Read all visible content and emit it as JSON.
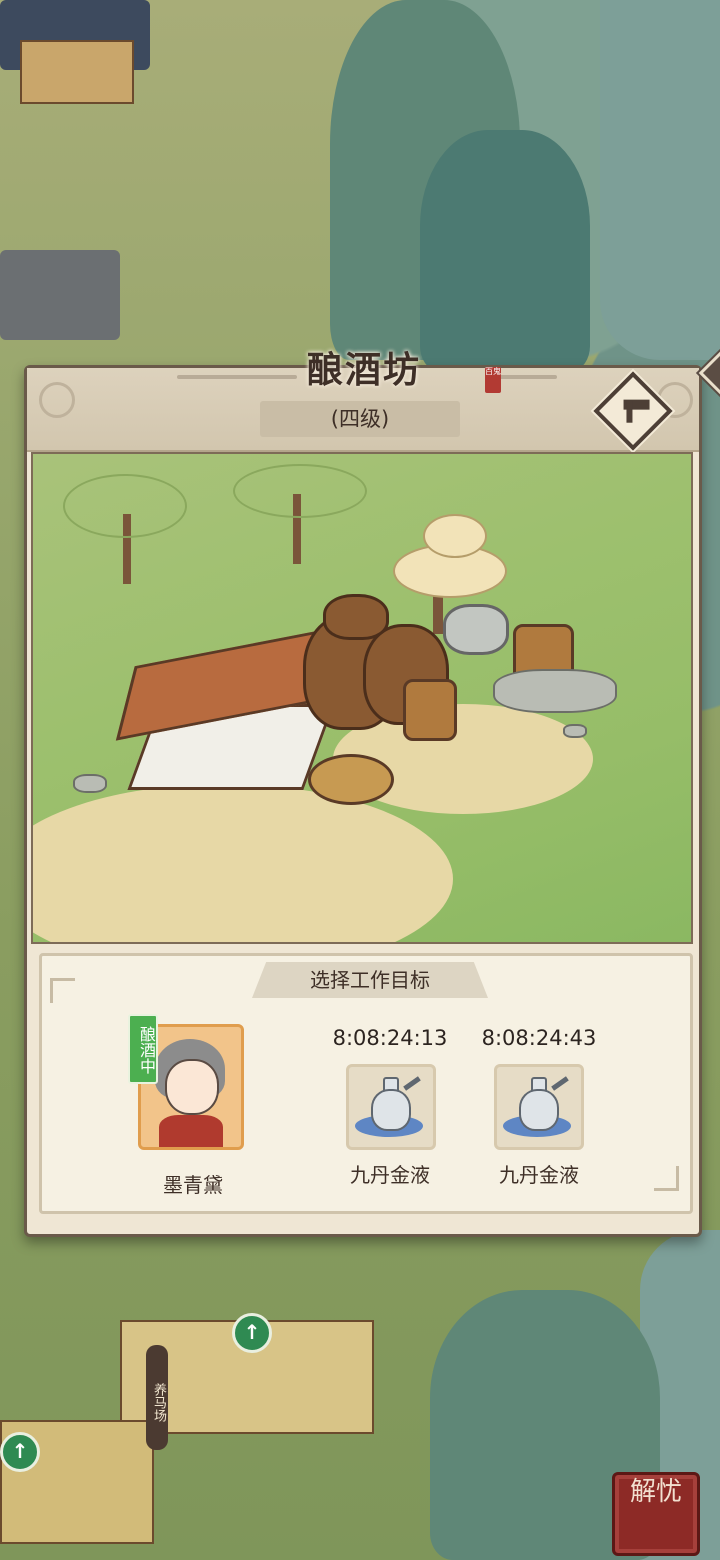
{
  "building": {
    "title": "酿酒坊",
    "level": "(四级)",
    "help_glyph": "?",
    "stamp": "百鬼"
  },
  "work": {
    "heading": "选择工作目标",
    "worker": {
      "name": "墨青黛",
      "status": "酿酒中"
    },
    "products": [
      {
        "timer": "8:08:24:13",
        "name": "九丹金液"
      },
      {
        "timer": "8:08:24:43",
        "name": "九丹金液"
      }
    ]
  },
  "map": {
    "stable_label": "养马场",
    "seal_button": "解忧",
    "upgrade_icon_glyph": "↑"
  },
  "colors": {
    "panel_bg": "#efe6d4",
    "panel_border": "#6a5a4a",
    "status_green": "#4caf50",
    "seal_red": "#8d2a26"
  }
}
